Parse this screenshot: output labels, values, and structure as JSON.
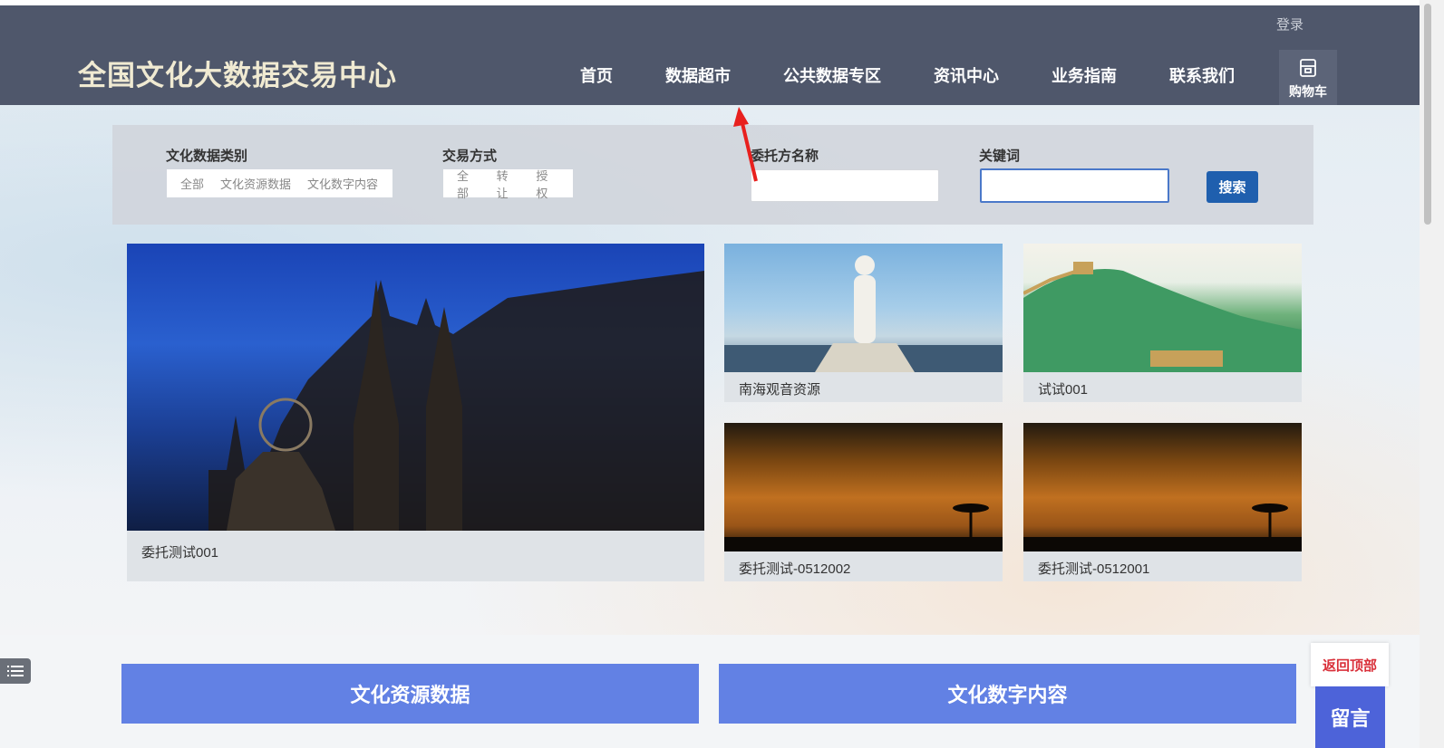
{
  "header": {
    "login": "登录",
    "logo": "全国文化大数据交易中心",
    "nav": [
      "首页",
      "数据超市",
      "公共数据专区",
      "资讯中心",
      "业务指南",
      "联系我们"
    ],
    "cart": "购物车"
  },
  "filter": {
    "category_label": "文化数据类别",
    "category_options": [
      "全部",
      "文化资源数据",
      "文化数字内容"
    ],
    "trade_label": "交易方式",
    "trade_options": [
      "全部",
      "转让",
      "授权"
    ],
    "client_label": "委托方名称",
    "client_value": "",
    "keyword_label": "关键词",
    "keyword_value": "",
    "search_button": "搜索"
  },
  "cards": {
    "featured": "委托测试001",
    "guanyin": "南海观音资源",
    "wall": "试试001",
    "sunset1": "委托测试-0512002",
    "sunset2": "委托测试-0512001"
  },
  "sections": {
    "resources": "文化资源数据",
    "content": "文化数字内容"
  },
  "float": {
    "back_top": "返回顶部",
    "message": "留言"
  },
  "colors": {
    "header_bg": "#4f576b",
    "accent_blue": "#1f5fae",
    "section_blue": "#6281e4",
    "message_blue": "#4d63d9",
    "back_top_red": "#d9303a"
  }
}
